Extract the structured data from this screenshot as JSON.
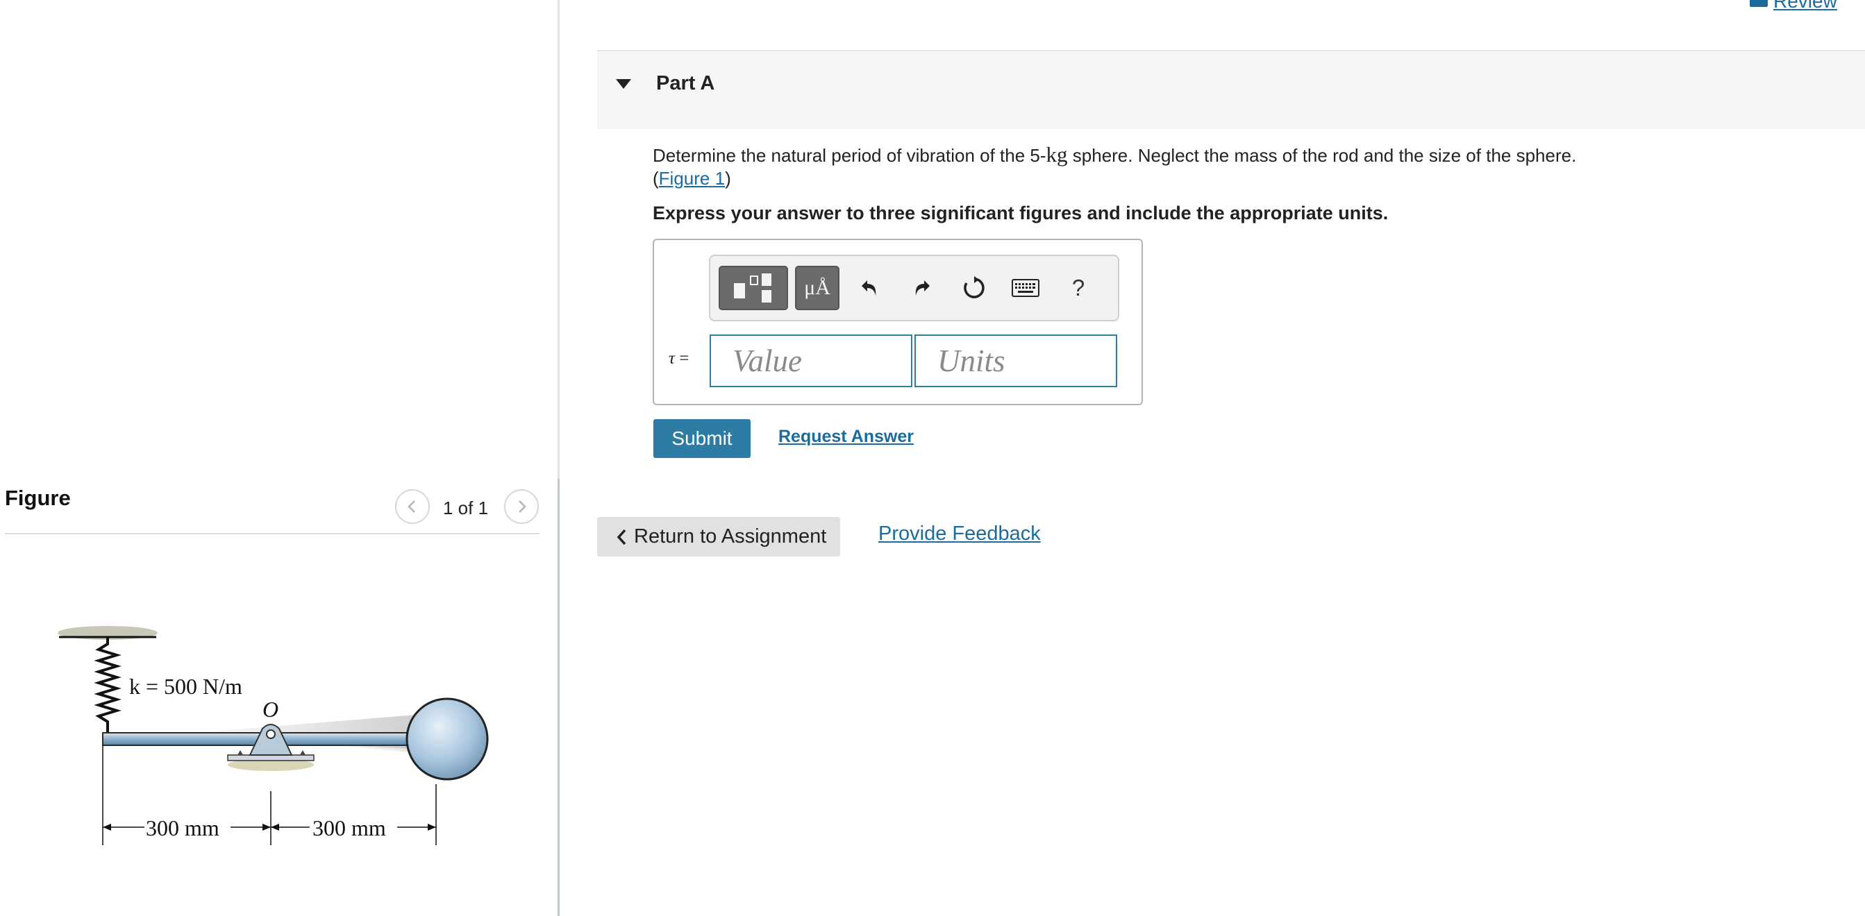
{
  "header": {
    "review_label": "Review"
  },
  "figure_panel": {
    "title": "Figure",
    "counter": "1 of 1",
    "labels": {
      "spring": "k = 500 N/m",
      "pivot": "O",
      "dim_left": "300 mm",
      "dim_right": "300 mm"
    }
  },
  "part": {
    "title": "Part A",
    "question_before": "Determine the natural period of vibration of the 5-",
    "question_unit": "kg",
    "question_after": " sphere. Neglect the mass of the rod and the size of the sphere.",
    "figure_link": "Figure 1",
    "instruction": "Express your answer to three significant figures and include the appropriate units."
  },
  "toolbar": {
    "units_label": "μÅ",
    "help_label": "?",
    "icons": [
      "templates-icon",
      "units-icon",
      "undo-icon",
      "redo-icon",
      "reset-icon",
      "keyboard-icon",
      "help-icon"
    ]
  },
  "answer": {
    "variable_label": "τ",
    "equals": "=",
    "value_placeholder": "Value",
    "units_placeholder": "Units"
  },
  "actions": {
    "submit_label": "Submit",
    "request_answer_label": "Request Answer",
    "return_label": "Return to Assignment",
    "feedback_label": "Provide Feedback"
  },
  "colors": {
    "accent": "#2d7ca3",
    "link": "#1a6c9e",
    "header_bg": "#f6f6f6",
    "button_gray": "#e1e1e1"
  }
}
